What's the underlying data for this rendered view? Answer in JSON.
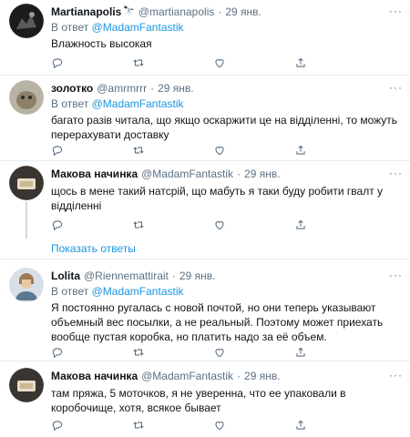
{
  "tweets": [
    {
      "name": "Martianapolis",
      "emoji": "🔭",
      "handle": "@martianapolis",
      "dot": "·",
      "date": "29 янв.",
      "reply_prefix": "В ответ",
      "reply_to": "@MadamFantastik",
      "text": "Влажность высокая"
    },
    {
      "name": "золотко",
      "handle": "@amrmrrr",
      "dot": "·",
      "date": "29 янв.",
      "reply_prefix": "В ответ",
      "reply_to": "@MadamFantastik",
      "text": "багато разів читала, що якщо оскаржити це на відділенні, то можуть перерахувати доставку"
    },
    {
      "name": "Макова начинка",
      "handle": "@MadamFantastik",
      "dot": "·",
      "date": "29 янв.",
      "text": "щось в мене такий натсрій, що мабуть я таки буду робити гвалт у відділенні"
    },
    {
      "name": "Lolita",
      "handle": "@Riennemattirait",
      "dot": "·",
      "date": "29 янв.",
      "reply_prefix": "В ответ",
      "reply_to": "@MadamFantastik",
      "text": "Я постоянно ругалась с новой почтой, но они теперь указывают объемный вес посылки, а не реальный. Поэтому может приехать вообще пустая коробка, но платить надо за её объем."
    },
    {
      "name": "Макова начинка",
      "handle": "@MadamFantastik",
      "dot": "·",
      "date": "29 янв.",
      "text": "там пряжа, 5 моточков, я не уверенна, что ее упаковали в коробочище, хотя, всякое бывает"
    }
  ],
  "show_replies": "Показать ответы",
  "more_glyph": "···",
  "icons": [
    "reply-icon",
    "retweet-icon",
    "like-icon",
    "share-icon",
    "more-icon"
  ],
  "colors": {
    "link": "#1b95e0",
    "secondary": "#5b7083",
    "divider": "#e6ecf0"
  }
}
